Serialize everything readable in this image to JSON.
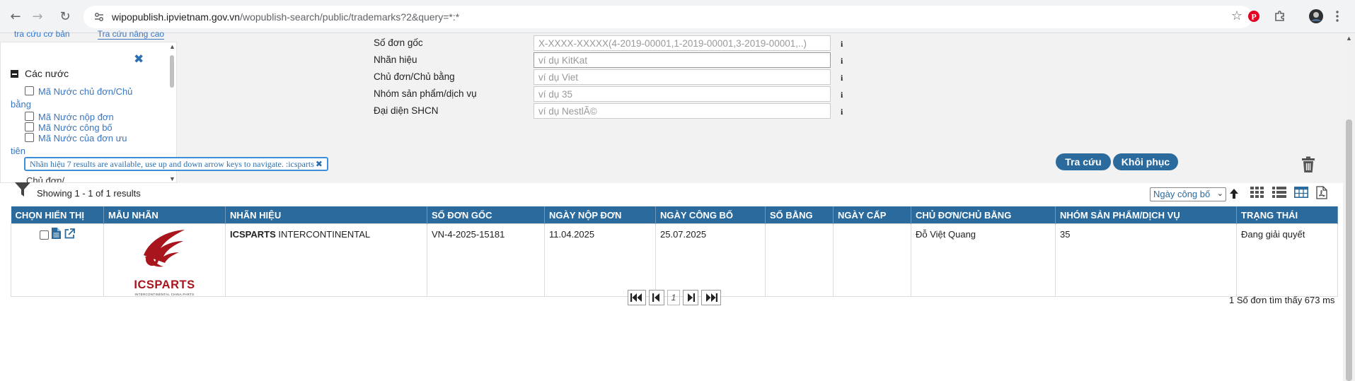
{
  "browser": {
    "url_host": "wipopublish.ipvietnam.gov.vn",
    "url_path": "/wopublish-search/public/trademarks?2&query=*:*"
  },
  "top_tabs": {
    "basic": "tra cứu cơ bản",
    "advanced": "Tra cứu nâng cao"
  },
  "side_panel": {
    "heading": "Các nước",
    "options": [
      "Mã Nước chủ đơn/Chủ bằng",
      "Mã Nước nộp đơn",
      "Mã Nước công bố",
      "Mã Nước của đơn ưu tiên"
    ],
    "next_heading": "Chủ đơn/..."
  },
  "search_form": {
    "fields": [
      {
        "label": "Số đơn gốc",
        "placeholder": "X-XXXX-XXXXX(4-2019-00001,1-2019-00001,3-2019-00001,..)"
      },
      {
        "label": "Nhãn hiệu",
        "placeholder": "ví dụ KitKat"
      },
      {
        "label": "Chủ đơn/Chủ bằng",
        "placeholder": "ví dụ Viet"
      },
      {
        "label": "Nhóm sản phẩm/dịch vụ",
        "placeholder": "ví dụ 35"
      },
      {
        "label": "Đại diện SHCN",
        "placeholder": "ví dụ NestlÃ©"
      }
    ],
    "info_glyph": "i",
    "search_button": "Tra cứu",
    "reset_button": "Khôi phục"
  },
  "filter_tag": {
    "text": "Nhãn hiệu 7 results are available, use up and down arrow keys to navigate. :icsparts"
  },
  "results": {
    "showing": "Showing 1 - 1 of 1 results",
    "sort_selected": "Ngày công bố",
    "columns": [
      "CHỌN HIỂN THỊ",
      "MẪU NHÃN",
      "NHÃN HIỆU",
      "SỐ ĐƠN GỐC",
      "NGÀY NỘP ĐƠN",
      "NGÀY CÔNG BỐ",
      "SỐ BẰNG",
      "NGÀY CẤP",
      "CHỦ ĐƠN/CHỦ BẰNG",
      "NHÓM SẢN PHẨM/DỊCH VỤ",
      "TRẠNG THÁI"
    ],
    "rows": [
      {
        "mark_bold": "ICSPARTS",
        "mark_rest": " INTERCONTINENTAL",
        "logo_text": "ICSPARTS",
        "logo_subtext": "INTERCONTINENTAL CHINA PARTS",
        "application_no": "VN-4-2025-15181",
        "filing_date": "11.04.2025",
        "publication_date": "25.07.2025",
        "registration_no": "",
        "grant_date": "",
        "owner": "Đỗ Việt Quang",
        "classes": "35",
        "status": "Đang giải quyết"
      }
    ],
    "page_number": "1",
    "found_text": "1 Số đơn tìm thấy 673 ms"
  }
}
